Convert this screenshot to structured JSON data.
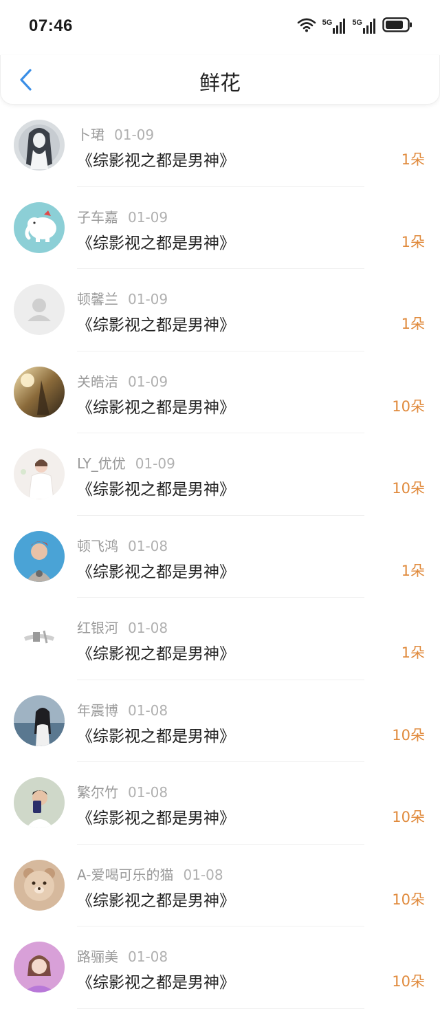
{
  "status": {
    "time": "07:46",
    "net1": "5G",
    "net2": "5G"
  },
  "header": {
    "title": "鲜花"
  },
  "colors": {
    "accent": "#e08a3c",
    "back": "#3a8ee6"
  },
  "items": [
    {
      "name": "卜珺",
      "date": "01-09",
      "book": "《综影视之都是男神》",
      "amount": "1朵",
      "avatar": "girl-art"
    },
    {
      "name": "子车嘉",
      "date": "01-09",
      "book": "《综影视之都是男神》",
      "amount": "1朵",
      "avatar": "elephant"
    },
    {
      "name": "顿馨兰",
      "date": "01-09",
      "book": "《综影视之都是男神》",
      "amount": "1朵",
      "avatar": "default-user"
    },
    {
      "name": "关皓洁",
      "date": "01-09",
      "book": "《综影视之都是男神》",
      "amount": "10朵",
      "avatar": "sunset"
    },
    {
      "name": "LY_优优",
      "date": "01-09",
      "book": "《综影视之都是男神》",
      "amount": "10朵",
      "avatar": "girl-white"
    },
    {
      "name": "顿飞鸿",
      "date": "01-08",
      "book": "《综影视之都是男神》",
      "amount": "1朵",
      "avatar": "person-blue"
    },
    {
      "name": "红银河",
      "date": "01-08",
      "book": "《综影视之都是男神》",
      "amount": "1朵",
      "avatar": "sketch"
    },
    {
      "name": "年震博",
      "date": "01-08",
      "book": "《综影视之都是男神》",
      "amount": "10朵",
      "avatar": "sea-girl"
    },
    {
      "name": "繁尔竹",
      "date": "01-08",
      "book": "《综影视之都是男神》",
      "amount": "10朵",
      "avatar": "boy-phone"
    },
    {
      "name": "A-爱喝可乐的猫",
      "date": "01-08",
      "book": "《综影视之都是男神》",
      "amount": "10朵",
      "avatar": "bear"
    },
    {
      "name": "路骊美",
      "date": "01-08",
      "book": "《综影视之都是男神》",
      "amount": "10朵",
      "avatar": "girl-purple"
    }
  ]
}
